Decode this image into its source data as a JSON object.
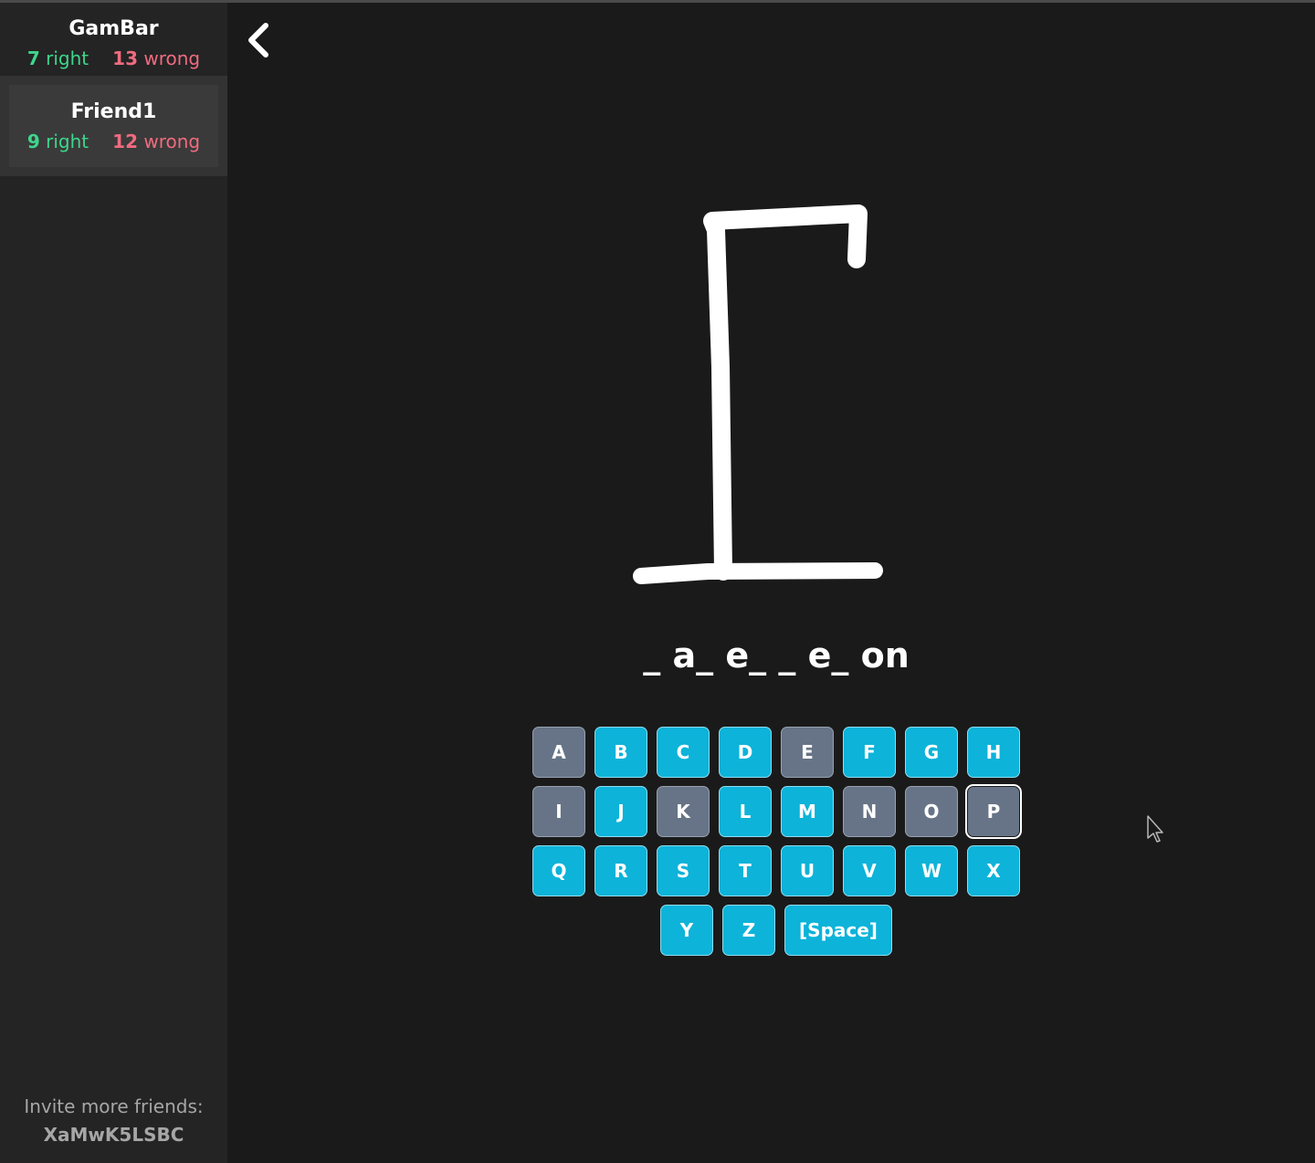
{
  "players": [
    {
      "name": "GamBar",
      "right_count": "7",
      "right_label": "right",
      "wrong_count": "13",
      "wrong_label": "wrong"
    },
    {
      "name": "Friend1",
      "right_count": "9",
      "right_label": "right",
      "wrong_count": "12",
      "wrong_label": "wrong"
    }
  ],
  "invite": {
    "label": "Invite more friends:",
    "code": "XaMwK5LSBC"
  },
  "game": {
    "word_display": "_ a_ e_ _ e_ on",
    "keyboard": {
      "row1": [
        "A",
        "B",
        "C",
        "D",
        "E",
        "F",
        "G",
        "H"
      ],
      "row2": [
        "I",
        "J",
        "K",
        "L",
        "M",
        "N",
        "O",
        "P"
      ],
      "row3": [
        "Q",
        "R",
        "S",
        "T",
        "U",
        "V",
        "W",
        "X"
      ],
      "row4": [
        "Y",
        "Z",
        "[Space]"
      ],
      "used_letters": [
        "A",
        "E",
        "I",
        "K",
        "N",
        "O",
        "P"
      ],
      "focused_key": "P"
    }
  },
  "colors": {
    "background": "#1a1a1a",
    "sidebar": "#242424",
    "key_available": "#0db3d9",
    "key_used": "#677487",
    "right": "#3dd68c",
    "wrong": "#f06b7f"
  },
  "icons": {
    "back": "chevron-left-icon",
    "cursor": "mouse-cursor-icon"
  }
}
